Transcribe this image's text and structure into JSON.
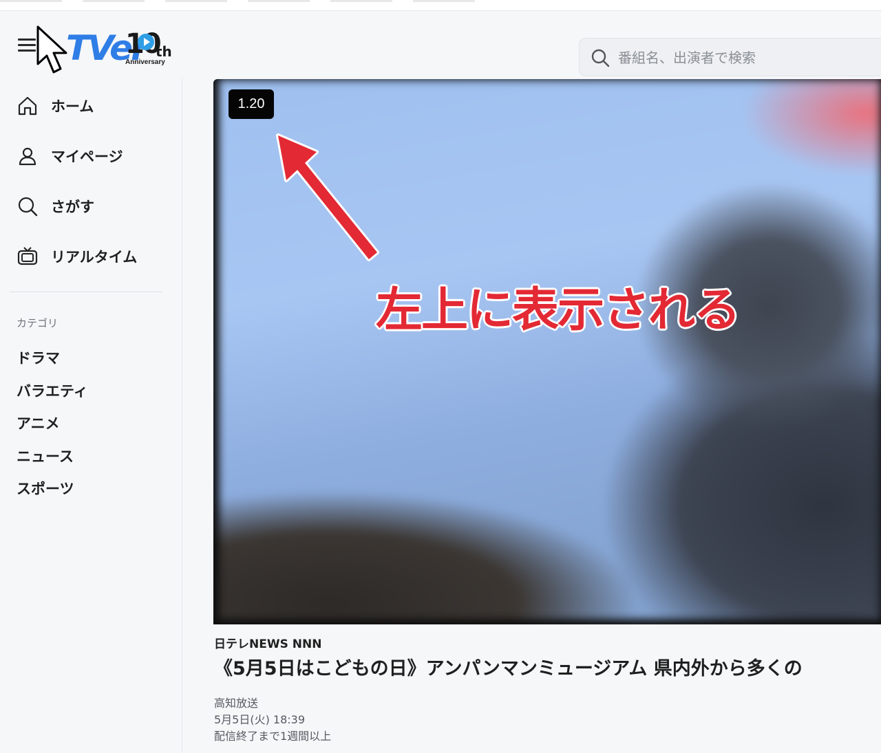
{
  "app": {
    "logo_text": "TVer",
    "logo_badge_number": "10",
    "logo_badge_suffix": "th",
    "logo_badge_label": "Anniversary",
    "accent_color": "#2f7de6"
  },
  "header": {
    "search": {
      "placeholder": "番組名、出演者で検索",
      "value": "",
      "icon": "search-icon"
    }
  },
  "sidebar": {
    "items": [
      {
        "label": "ホーム",
        "icon": "home-icon"
      },
      {
        "label": "マイページ",
        "icon": "user-icon"
      },
      {
        "label": "さがす",
        "icon": "search-icon"
      },
      {
        "label": "リアルタイム",
        "icon": "tv-icon"
      }
    ],
    "category_title": "カテゴリ",
    "categories": [
      "ドラマ",
      "バラエティ",
      "アニメ",
      "ニュース",
      "スポーツ"
    ]
  },
  "player": {
    "playback_rate": "1.20",
    "annotation_text": "左上に表示される",
    "annotation_color": "#e32934"
  },
  "episode": {
    "channel": "日テレNEWS NNN",
    "title": "《5月5日はこどもの日》アンパンマンミュージアム 県内外から多くの",
    "broadcaster": "高知放送",
    "datetime": "5月5日(火) 18:39",
    "availability": "配信終了まで1週間以上"
  }
}
